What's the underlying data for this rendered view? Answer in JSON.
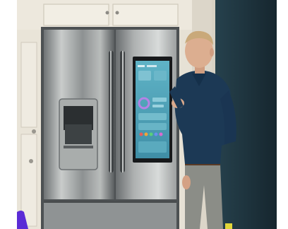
{
  "scene": {
    "description_colors": {
      "wall": "#e9e4d9",
      "cabinet": "#ece7dc",
      "door_dark": "#1f3640",
      "steel_light": "#d4d7d6",
      "steel_dark": "#5b5f61",
      "screen_blue": "#4ea4b8",
      "shirt": "#1b3a55",
      "pants": "#8a8c86",
      "accent_purple": "#5a2bd6",
      "accent_yellow": "#e2d63a"
    }
  }
}
